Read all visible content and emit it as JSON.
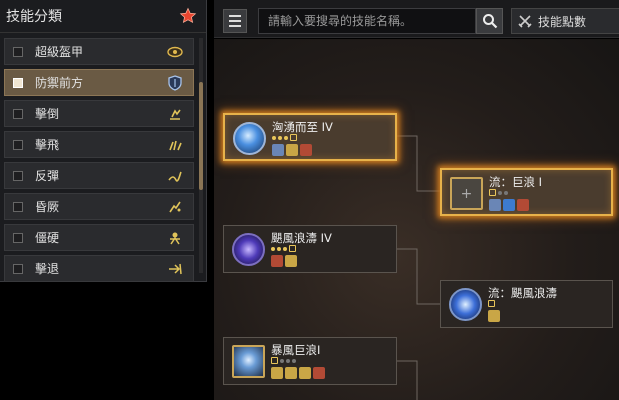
{
  "category_panel": {
    "title": "技能分類",
    "items": [
      {
        "label": "超級盔甲",
        "selected": false,
        "icon": "eye-icon"
      },
      {
        "label": "防禦前方",
        "selected": true,
        "icon": "shield-icon"
      },
      {
        "label": "擊倒",
        "selected": false,
        "icon": "knockdown-icon"
      },
      {
        "label": "擊飛",
        "selected": false,
        "icon": "airborne-icon"
      },
      {
        "label": "反彈",
        "selected": false,
        "icon": "bounce-icon"
      },
      {
        "label": "昏厥",
        "selected": false,
        "icon": "stun-icon"
      },
      {
        "label": "僵硬",
        "selected": false,
        "icon": "stiffness-icon"
      },
      {
        "label": "擊退",
        "selected": false,
        "icon": "knockback-icon"
      }
    ]
  },
  "toolbar": {
    "search_placeholder": "請輸入要搜尋的技能名稱。",
    "points_label": "技能點數"
  },
  "nodes": [
    {
      "title": "洶湧而至 IV",
      "stars": [
        "on",
        "on",
        "on",
        "box"
      ]
    },
    {
      "title": "流：巨浪 I",
      "stars": [
        "box",
        "off",
        "off"
      ]
    },
    {
      "title": "颶風浪濤 IV",
      "stars": [
        "on",
        "on",
        "on",
        "box"
      ]
    },
    {
      "title": "流：颶風浪濤",
      "stars": [
        "box"
      ]
    },
    {
      "title": "暴風巨浪I",
      "stars": [
        "box",
        "off",
        "off",
        "off"
      ]
    }
  ],
  "colors": {
    "accent": "#e7b24a",
    "selected_bg": "#6a5a44",
    "panel_bg": "#1b1c1f"
  }
}
